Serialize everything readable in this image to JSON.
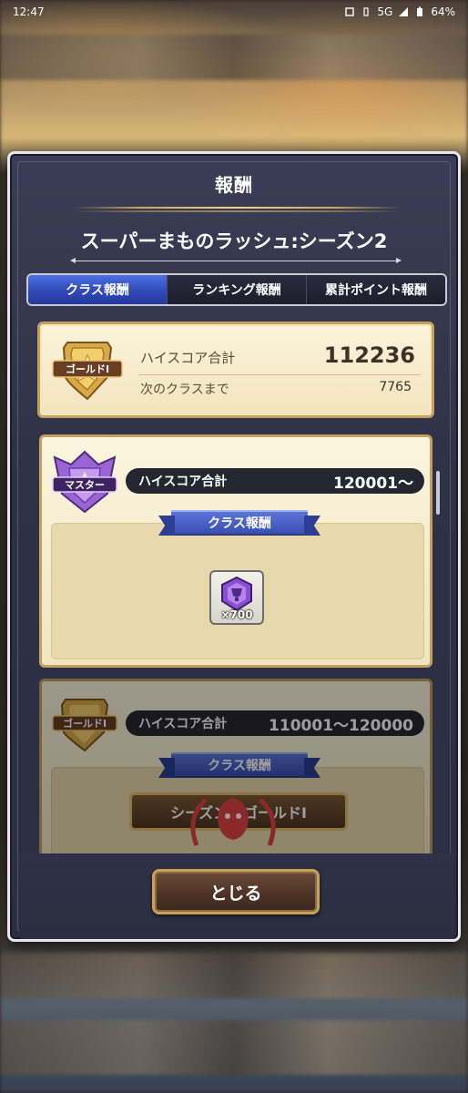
{
  "status_bar": {
    "time": "12:47",
    "network": "5G",
    "battery": "64%"
  },
  "dialog": {
    "title": "報酬",
    "subtitle": "スーパーまものラッシュ:シーズン2",
    "close_label": "とじる"
  },
  "tabs": [
    {
      "label": "クラス報酬",
      "active": true
    },
    {
      "label": "ランキング報酬",
      "active": false
    },
    {
      "label": "累計ポイント報酬",
      "active": false
    }
  ],
  "summary": {
    "badge_label": "ゴールドⅠ",
    "high_score_label": "ハイスコア合計",
    "high_score_value": "112236",
    "next_class_label": "次のクラスまで",
    "next_class_value": "7765"
  },
  "reward_cards": [
    {
      "badge_label": "マスター",
      "score_label": "ハイスコア合計",
      "score_range": "120001〜",
      "banner": "クラス報酬",
      "item_qty": "×700"
    },
    {
      "badge_label": "ゴールドⅠ",
      "score_label": "ハイスコア合計",
      "score_range": "110001〜120000",
      "banner": "クラス報酬",
      "plate_text": "シーズン2 ゴールドⅠ"
    }
  ],
  "colors": {
    "tab_active": "#2f49b8",
    "panel_bg": "#f2e4bc",
    "panel_border": "#c4a060",
    "dialog_bg": "#2f3247"
  }
}
